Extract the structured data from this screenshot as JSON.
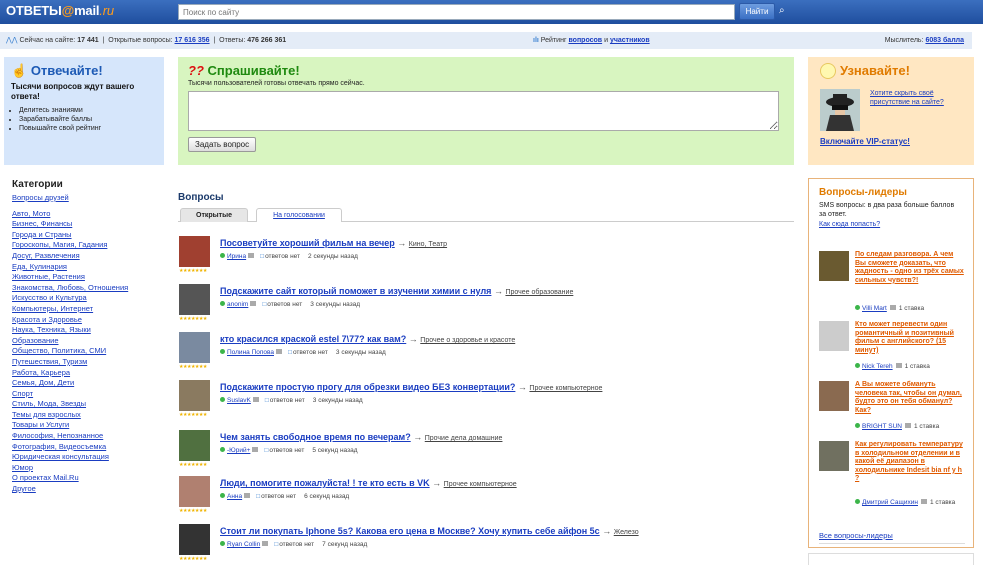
{
  "header": {
    "logo_main": "ОТВЕТЫ",
    "logo_at": "@",
    "logo_mail": "mail",
    "logo_ru": ".ru",
    "search_placeholder": "Поиск по сайту",
    "find_label": "Найти",
    "advanced_icon": "search-settings-icon"
  },
  "stats": {
    "online_label": "Сейчас на сайте:",
    "online_count": "17 441",
    "open_label": "Открытые вопросы:",
    "open_count": "17 616 356",
    "answers_label": "Ответы:",
    "answers_count": "476 266 361",
    "rating_label": "Рейтинг",
    "rating_questions": "вопросов",
    "rating_and": "и",
    "rating_participants": "участников",
    "user_rank_label": "Мыслитель:",
    "user_points": "6083 балла"
  },
  "answer_block": {
    "title": "Отвечайте!",
    "subtitle": "Тысячи вопросов ждут вашего ответа!",
    "bullets": [
      "Делитесь знаниями",
      "Зарабатывайте баллы",
      "Повышайте свой рейтинг"
    ]
  },
  "ask_block": {
    "title": "Спрашивайте!",
    "icon": "??",
    "subtitle": "Тысячи пользователей готовы отвечать прямо сейчас.",
    "button": "Задать вопрос"
  },
  "learn_block": {
    "title": "Узнавайте!",
    "hide_presence": "Хотите скрыть своё присутствие на сайте?",
    "vip": "Включайте VIP-статус!"
  },
  "categories": {
    "title": "Категории",
    "items": [
      "Вопросы друзей",
      "Авто, Мото",
      "Бизнес, Финансы",
      "Города и Страны",
      "Гороскопы, Магия, Гадания",
      "Досуг, Развлечения",
      "Еда, Кулинария",
      "Животные, Растения",
      "Знакомства, Любовь, Отношения",
      "Искусство и Культура",
      "Компьютеры, Интернет",
      "Красота и Здоровье",
      "Наука, Техника, Языки",
      "Образование",
      "Общество, Политика, СМИ",
      "Путешествия, Туризм",
      "Работа, Карьера",
      "Семья, Дом, Дети",
      "Спорт",
      "Стиль, Мода, Звезды",
      "Темы для взрослых",
      "Товары и Услуги",
      "Философия, Непознанное",
      "Фотография, Видеосъемка",
      "Юридическая консультация",
      "Юмор",
      "О проектах Mail.Ru",
      "Другое"
    ]
  },
  "questions": {
    "title": "Вопросы",
    "tabs": [
      "Открытые",
      "На голосовании"
    ],
    "items": [
      {
        "title": "Посоветуйте хороший фильм на вечер",
        "category": "Кино, Театр",
        "user": "Ирина",
        "answers": "ответов нет",
        "time": "2 секунды назад",
        "thumb": "#a04030"
      },
      {
        "title": "Подскажите сайт который поможет в изучении химии с нуля",
        "category": "Прочее образование",
        "user": "anonim",
        "answers": "ответов нет",
        "time": "3 секунды назад",
        "thumb": "#555"
      },
      {
        "title": "кто красился краской estel 7\\77? как вам?",
        "category": "Прочее о здоровье и красоте",
        "user": "Полина Попова",
        "answers": "ответов нет",
        "time": "3 секунды назад",
        "thumb": "#7a8aa0"
      },
      {
        "title": "Подскажите простую прогу для обрезки видео БЕЗ конвертации?",
        "category": "Прочее компьютерное",
        "user": "SuslavK",
        "answers": "ответов нет",
        "time": "3 секунды назад",
        "thumb": "#8a7a60"
      },
      {
        "title": "Чем занять свободное время по вечерам?",
        "category": "Прочие дела домашние",
        "user": "-Юрий+",
        "answers": "ответов нет",
        "time": "5 секунд назад",
        "thumb": "#507040"
      },
      {
        "title": "Люди, помогите пожалуйста! ! те кто есть в VK",
        "category": "Прочее компьютерное",
        "user": "Анна",
        "answers": "ответов нет",
        "time": "6 секунд назад",
        "thumb": "#b08070"
      },
      {
        "title": "Стоит ли покупать Iphone 5s? Какова его цена в Москве? Хочу купить себе айфон 5с",
        "category": "Железо",
        "user": "Ryan Collin",
        "answers": "ответов нет",
        "time": "7 секунд назад",
        "thumb": "#333"
      }
    ]
  },
  "leaders": {
    "title": "Вопросы-лидеры",
    "sms": "SMS вопросы: в два раза больше баллов за ответ.",
    "how": "Как сюда попасть?",
    "items": [
      {
        "title": "По следам разговора. А чем Вы сможете доказать, что жадность - одно из трёх самых сильных чувств?!",
        "user": "Villi Mart",
        "stake": "1 ставка",
        "thumb": "#6a5a30"
      },
      {
        "title": "Кто может перевести один романтичный и позитивный фильм с английского? (15 минут)",
        "user": "Nick Tereh",
        "stake": "1 ставка",
        "thumb": "#ccc"
      },
      {
        "title": "А Вы можете обмануть человека так, чтобы он думал, будто это он тебя обманул? Как?",
        "user": "BRIGHT SUN",
        "stake": "1 ставка",
        "thumb": "#8a6a50"
      },
      {
        "title": "Как регулировать температуру в холодильном отделении и в какой её диапазон в холодильнике Indesit bia nf y h ?",
        "user": "Дмитрий Сащихин",
        "stake": "1 ставка",
        "thumb": "#707060"
      }
    ],
    "all": "Все вопросы-лидеры"
  },
  "colors": {
    "topbar": "#1f4e9e",
    "accent_orange": "#e07b00",
    "ask_green": "#1f8a10",
    "link": "#1a3dc1"
  }
}
